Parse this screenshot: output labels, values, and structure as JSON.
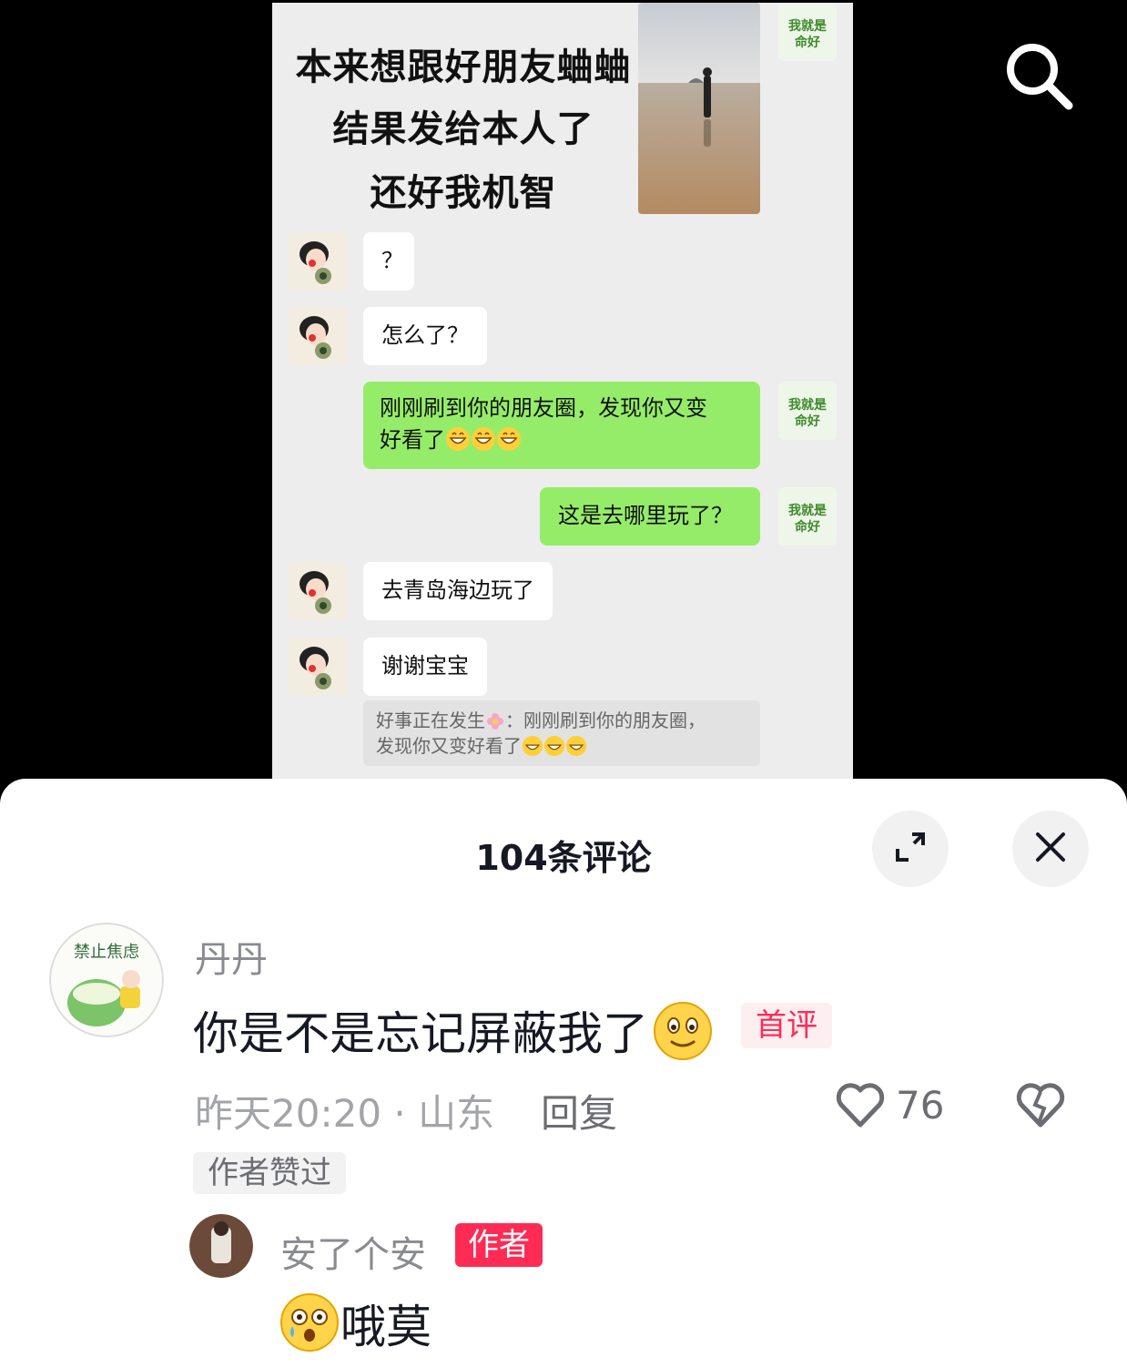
{
  "video": {
    "headline": [
      "本来想跟好朋友蛐蛐",
      "结果发给本人了",
      "还好我机智"
    ],
    "messages": [
      {
        "side": "in",
        "text": "？"
      },
      {
        "side": "in",
        "text": "怎么了？"
      },
      {
        "side": "out",
        "text": "刚刚刷到你的朋友圈，发现你又变",
        "text2": "好看了"
      },
      {
        "side": "out",
        "text": "这是去哪里玩了？"
      },
      {
        "side": "in",
        "text": "去青岛海边玩了"
      },
      {
        "side": "in",
        "text": "谢谢宝宝"
      }
    ],
    "quote": {
      "line1_a": "好事正在发生",
      "line1_b": "：刚刚刷到你的朋友圈，",
      "line2": "发现你又变好看了"
    },
    "avatar_sticker_text": "我就是命好",
    "icons": {
      "search": "search-icon",
      "grin": "grinning-emoji-icon",
      "flower": "flower-emoji-icon"
    }
  },
  "sheet": {
    "title": "104条评论",
    "icons": {
      "expand": "expand-icon",
      "close": "close-icon",
      "like": "heart-icon",
      "dislike": "broken-heart-icon"
    }
  },
  "comment": {
    "username": "丹丹",
    "text": "你是不是忘记屏蔽我了",
    "emoji": "smile-emoji-icon",
    "tag": "首评",
    "time": "昨天20:20",
    "separator": "·",
    "location": "山东",
    "reply_label": "回复",
    "likes": "76",
    "author_liked": "作者赞过",
    "avatar_text": "禁止焦虑"
  },
  "reply": {
    "username": "安了个安",
    "tag": "作者",
    "emoji": "crying-surprised-emoji-icon",
    "text": "哦莫"
  },
  "colors": {
    "accent": "#fe2c55",
    "chat_green": "#95ec69",
    "chat_bg": "#ededed"
  }
}
